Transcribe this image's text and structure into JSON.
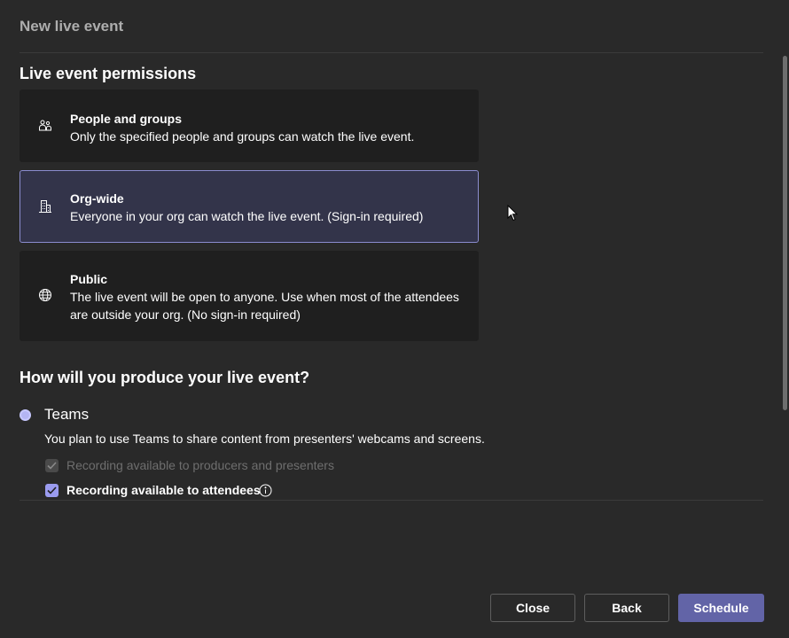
{
  "dialog": {
    "title": "New live event"
  },
  "permissions": {
    "heading": "Live event permissions",
    "options": [
      {
        "title": "People and groups",
        "description": "Only the specified people and groups can watch the live event.",
        "icon": "people-icon",
        "selected": false
      },
      {
        "title": "Org-wide",
        "description": "Everyone in your org can watch the live event. (Sign-in required)",
        "icon": "building-icon",
        "selected": true
      },
      {
        "title": "Public",
        "description": "The live event will be open to anyone. Use when most of the attendees are outside your org. (No sign-in required)",
        "icon": "globe-icon",
        "selected": false
      }
    ]
  },
  "production": {
    "heading": "How will you produce your live event?",
    "method": {
      "label": "Teams",
      "description": "You plan to use Teams to share content from presenters' webcams and screens.",
      "selected": true
    },
    "checkboxes": [
      {
        "label": "Recording available to producers and presenters",
        "checked": true,
        "disabled": true
      },
      {
        "label": "Recording available to attendees",
        "checked": true,
        "disabled": false,
        "icon": "info-icon"
      }
    ]
  },
  "footer": {
    "close_label": "Close",
    "back_label": "Back",
    "schedule_label": "Schedule"
  },
  "colors": {
    "background": "#292929",
    "card": "#1f1f1f",
    "selected_card": "#33344a",
    "accent": "#6264a7",
    "accent_light": "#9a9bef"
  }
}
